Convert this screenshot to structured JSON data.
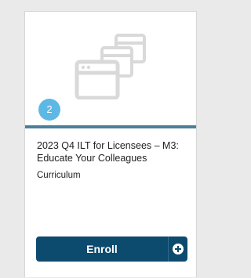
{
  "card": {
    "item_count": "2",
    "title": "2023 Q4 ILT for Licensees – M3: Educate Your Colleagues",
    "type_label": "Curriculum",
    "enroll_label": "Enroll",
    "thumbnail_icon": "stacked-windows-icon",
    "action_icon": "plus-circle-icon",
    "colors": {
      "badge": "#5db8e6",
      "divider": "#4c7f99",
      "enroll_button": "#0c4a6e",
      "icon": "#d9d9d9"
    }
  }
}
